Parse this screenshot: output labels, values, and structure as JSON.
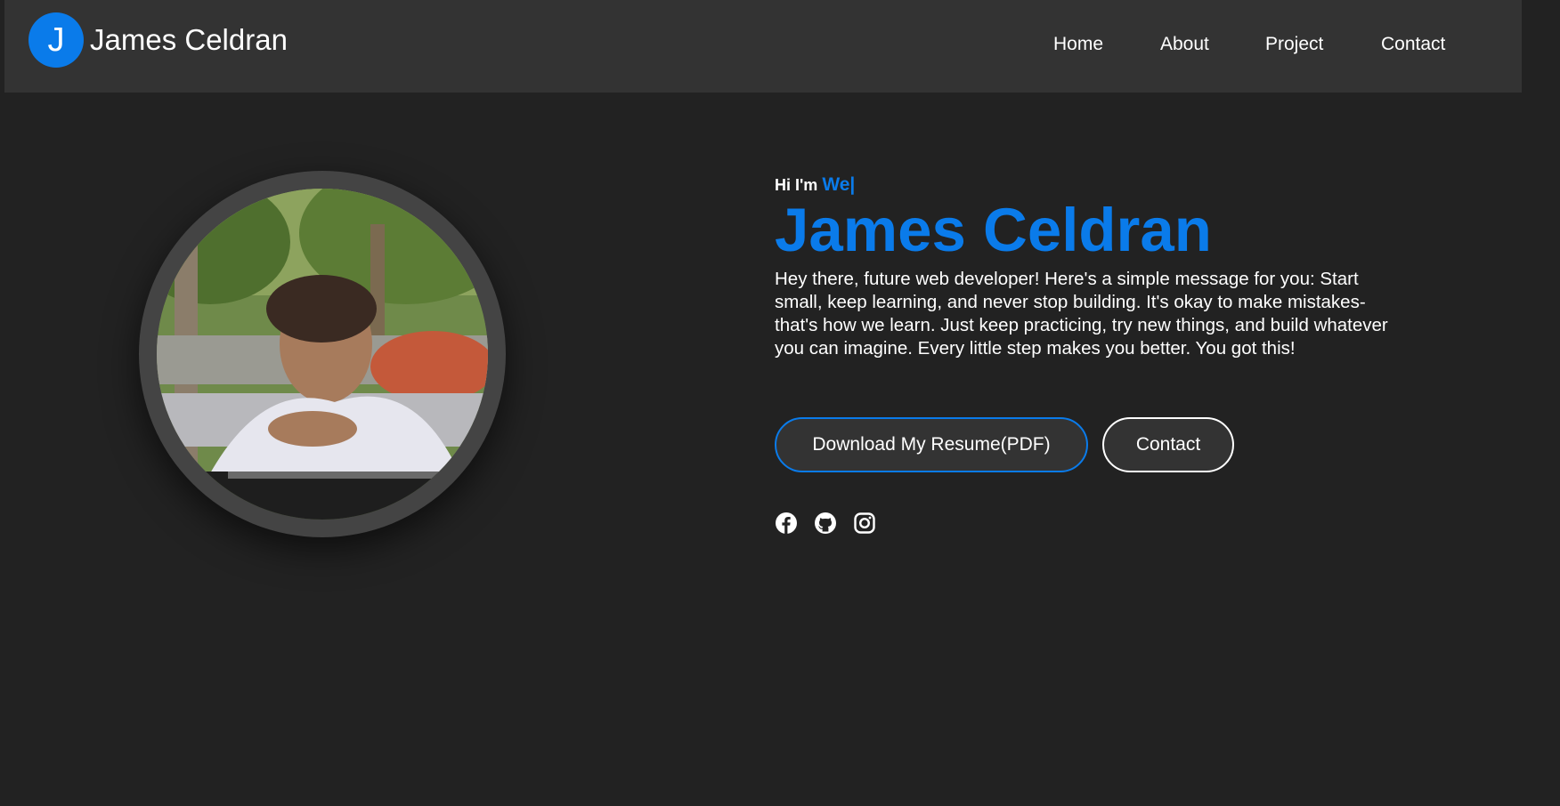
{
  "header": {
    "logo_letter": "J",
    "brand_name": "James Celdran",
    "nav": {
      "home": "Home",
      "about": "About",
      "project": "Project",
      "contact": "Contact"
    }
  },
  "hero": {
    "greeting_prefix": "Hi I'm",
    "typed_text": "We|",
    "name": "James Celdran",
    "message": "Hey there, future web developer! Here's a simple message for you: Start small, keep learning, and never stop building. It's okay to make mistakes-that's how we learn. Just keep practicing, try new things, and build whatever you can imagine. Every little step makes you better. You got this!",
    "buttons": {
      "resume": "Download My Resume(PDF)",
      "contact": "Contact"
    },
    "socials": [
      "facebook-icon",
      "github-icon",
      "instagram-icon"
    ]
  },
  "colors": {
    "accent": "#0a7bea",
    "background": "#222222",
    "navbar": "#333333",
    "text": "#ffffff"
  }
}
